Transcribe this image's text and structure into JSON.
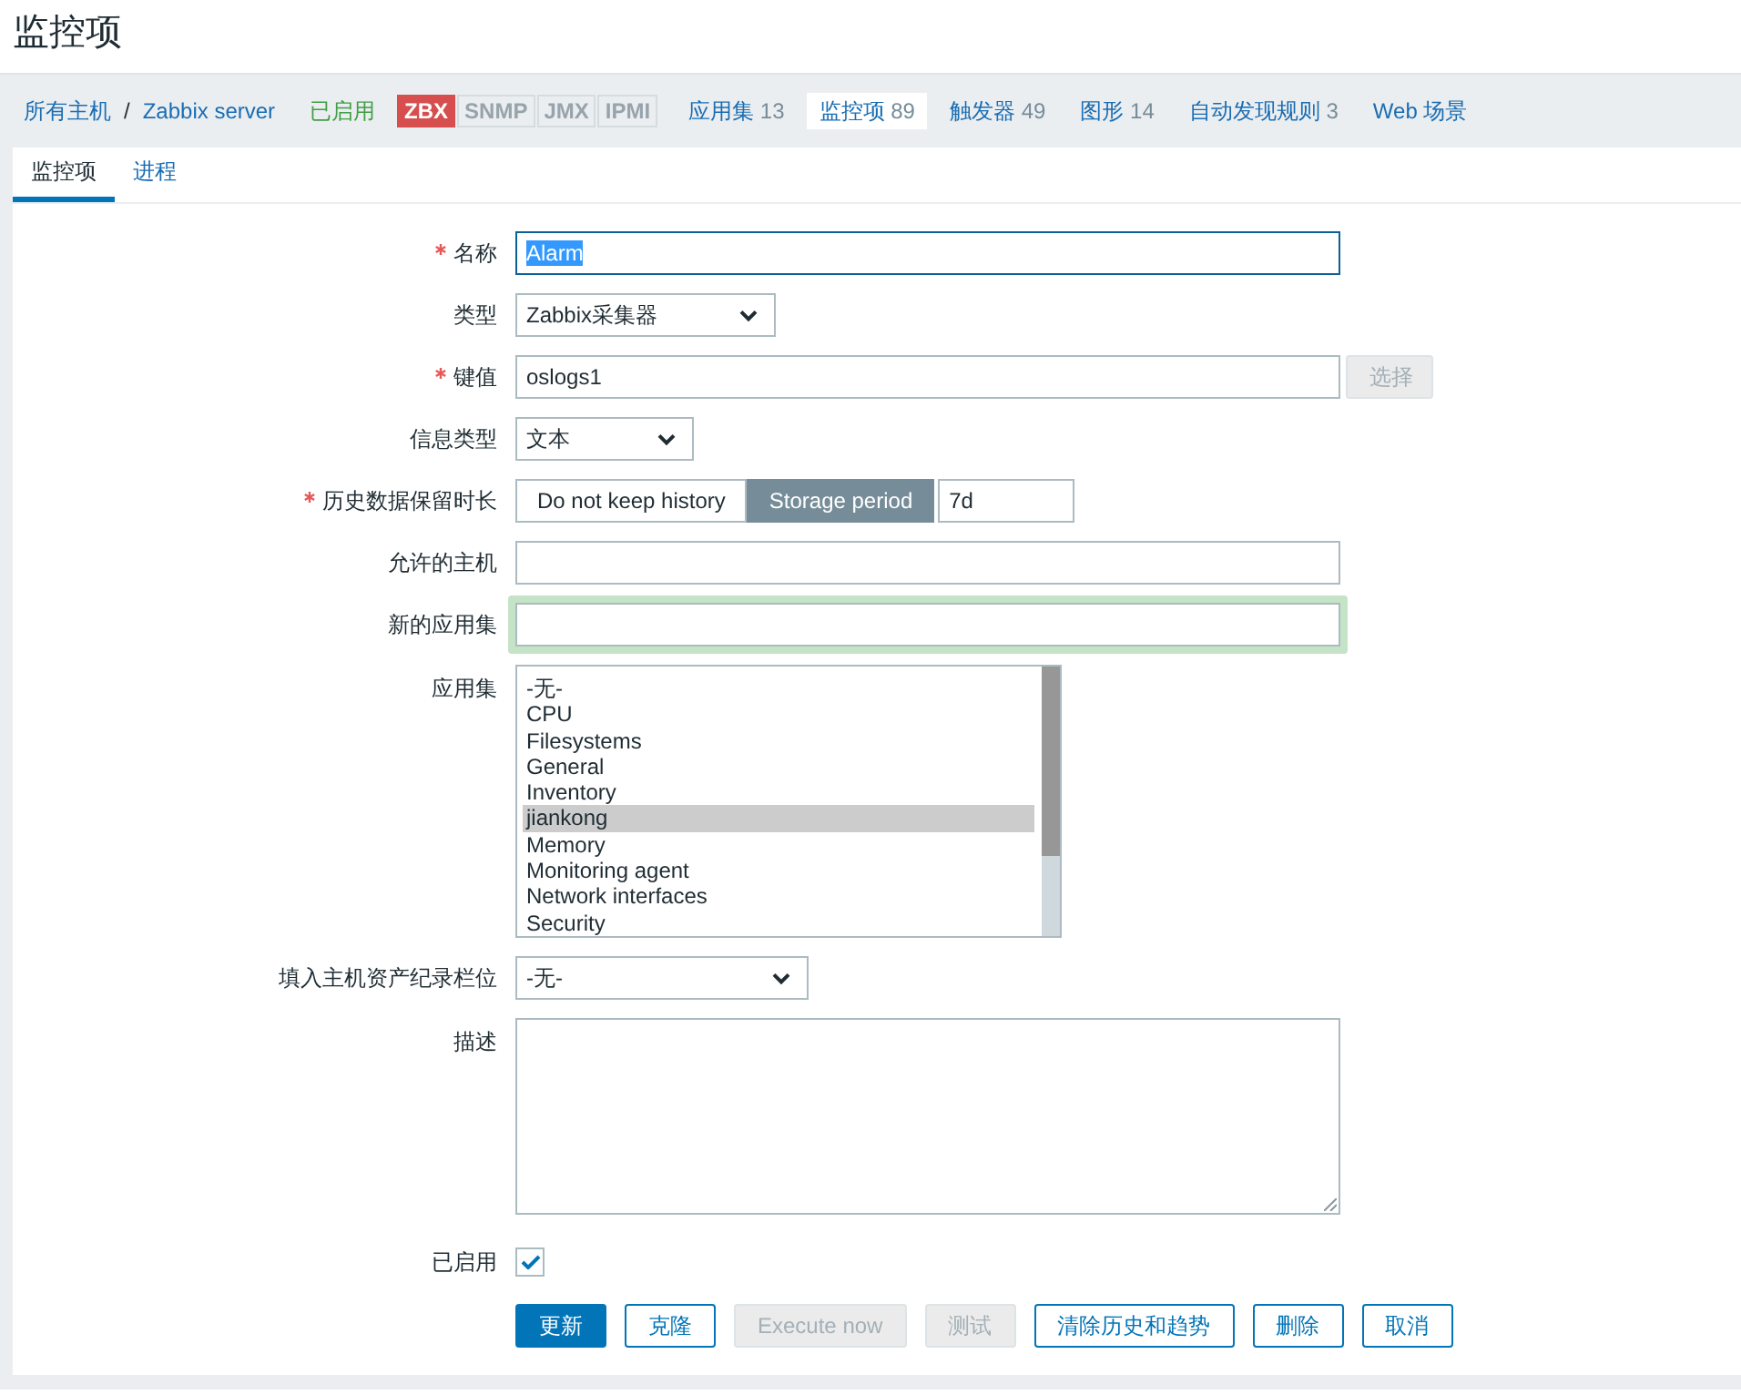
{
  "page": {
    "title": "监控项"
  },
  "host_nav": {
    "breadcrumb": {
      "items": [
        "所有主机",
        "Zabbix server"
      ],
      "separator": "/"
    },
    "status": {
      "label": "已启用",
      "kind": "enabled"
    },
    "interfaces": [
      {
        "label": "ZBX",
        "kind": "unavailable"
      },
      {
        "label": "SNMP",
        "kind": "unknown"
      },
      {
        "label": "JMX",
        "kind": "unknown"
      },
      {
        "label": "IPMI",
        "kind": "unknown"
      }
    ],
    "links": [
      {
        "label": "应用集",
        "count": "13",
        "selected": false
      },
      {
        "label": "监控项",
        "count": "89",
        "selected": true
      },
      {
        "label": "触发器",
        "count": "49",
        "selected": false
      },
      {
        "label": "图形",
        "count": "14",
        "selected": false
      },
      {
        "label": "自动发现规则",
        "count": "3",
        "selected": false
      },
      {
        "label": "Web 场景",
        "selected": false
      }
    ]
  },
  "tabs": [
    {
      "label": "监控项",
      "selected": true
    },
    {
      "label": "进程",
      "selected": false
    }
  ],
  "form": {
    "fields": [
      {
        "kind": "text",
        "label": "名称",
        "required": true,
        "value": "Alarm",
        "focused": true,
        "highlighted": false,
        "value_selected": true
      },
      {
        "kind": "select",
        "label": "类型",
        "required": false,
        "value": "Zabbix采集器"
      },
      {
        "kind": "text_with_button",
        "label": "键值",
        "required": true,
        "value": "oslogs1",
        "button": {
          "label": "选择",
          "disabled": true
        }
      },
      {
        "kind": "select",
        "label": "信息类型",
        "required": false,
        "value": "文本"
      },
      {
        "kind": "radio_input",
        "label": "历史数据保留时长",
        "required": true,
        "options": [
          {
            "label": "Do not keep history",
            "selected": false
          },
          {
            "label": "Storage period",
            "selected": true
          }
        ],
        "value": "7d"
      },
      {
        "kind": "text",
        "label": "允许的主机",
        "required": false,
        "focused": false,
        "highlighted": false
      },
      {
        "kind": "text",
        "label": "新的应用集",
        "required": false,
        "focused": false,
        "highlighted": true
      },
      {
        "kind": "listbox",
        "label": "应用集",
        "required": false,
        "options": [
          {
            "label": "-无-",
            "selected": false
          },
          {
            "label": "CPU",
            "selected": false
          },
          {
            "label": "Filesystems",
            "selected": false
          },
          {
            "label": "General",
            "selected": false
          },
          {
            "label": "Inventory",
            "selected": false
          },
          {
            "label": "jiankong",
            "selected": true
          },
          {
            "label": "Memory",
            "selected": false
          },
          {
            "label": "Monitoring agent",
            "selected": false
          },
          {
            "label": "Network interfaces",
            "selected": false
          },
          {
            "label": "Security",
            "selected": false
          }
        ]
      },
      {
        "kind": "select",
        "label": "填入主机资产纪录栏位",
        "required": false,
        "value": "-无-"
      },
      {
        "kind": "textarea",
        "label": "描述",
        "required": false
      },
      {
        "kind": "checkbox",
        "label": "已启用",
        "required": false,
        "checked": true
      }
    ],
    "buttons": [
      {
        "label": "更新",
        "kind": "primary",
        "disabled": false
      },
      {
        "label": "克隆",
        "kind": "secondary",
        "disabled": false
      },
      {
        "label": "Execute now",
        "kind": "secondary",
        "disabled": true
      },
      {
        "label": "测试",
        "kind": "secondary",
        "disabled": true
      },
      {
        "label": "清除历史和趋势",
        "kind": "secondary",
        "disabled": false
      },
      {
        "label": "删除",
        "kind": "secondary",
        "disabled": false
      },
      {
        "label": "取消",
        "kind": "secondary",
        "disabled": false
      }
    ]
  }
}
